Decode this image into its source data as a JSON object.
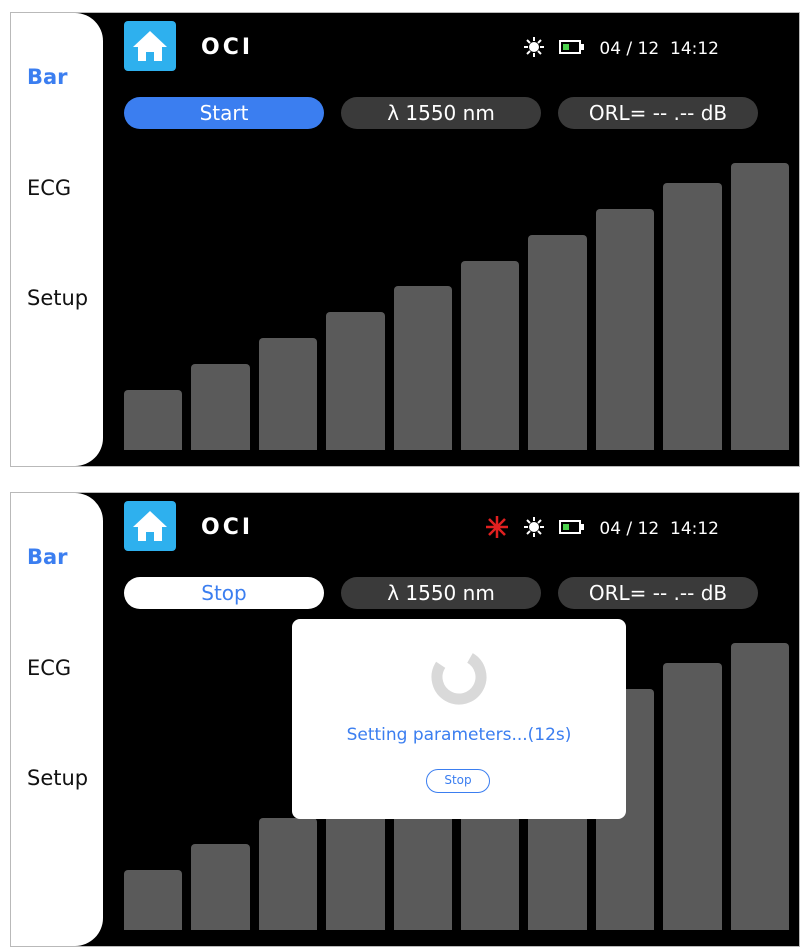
{
  "screens": [
    {
      "sidebar": {
        "items": [
          {
            "label": "Bar",
            "active": true
          },
          {
            "label": "ECG"
          },
          {
            "label": "Setup"
          }
        ]
      },
      "header": {
        "title": "OCI",
        "date": "04 / 12",
        "time": "14:12",
        "icons": [
          "brightness-icon",
          "battery-icon"
        ]
      },
      "controls": {
        "action_label": "Start",
        "wavelength": "λ  1550 nm",
        "orl": "ORL= -- .--  dB"
      },
      "bars": {
        "levels": [
          0.21,
          0.3,
          0.39,
          0.48,
          0.57,
          0.66,
          0.75,
          0.84,
          0.93,
          1.0
        ]
      }
    },
    {
      "sidebar": {
        "items": [
          {
            "label": "Bar",
            "active": true
          },
          {
            "label": "ECG"
          },
          {
            "label": "Setup"
          }
        ]
      },
      "header": {
        "title": "OCI",
        "date": "04 / 12",
        "time": "14:12",
        "icons": [
          "laser-icon",
          "brightness-icon",
          "battery-icon"
        ]
      },
      "controls": {
        "action_label": "Stop",
        "wavelength": "λ  1550 nm",
        "orl": "ORL= -- .--  dB"
      },
      "bars": {
        "levels": [
          0.21,
          0.3,
          0.39,
          0.48,
          0.57,
          0.66,
          0.75,
          0.84,
          0.93,
          1.0
        ]
      },
      "dialog": {
        "message": "Setting parameters...(12s)",
        "stop_label": "Stop"
      }
    }
  ],
  "colors": {
    "accent": "#3b7ef0",
    "home": "#2eb0ee",
    "bar": "#5a5a5a",
    "laser": "#e02020"
  }
}
